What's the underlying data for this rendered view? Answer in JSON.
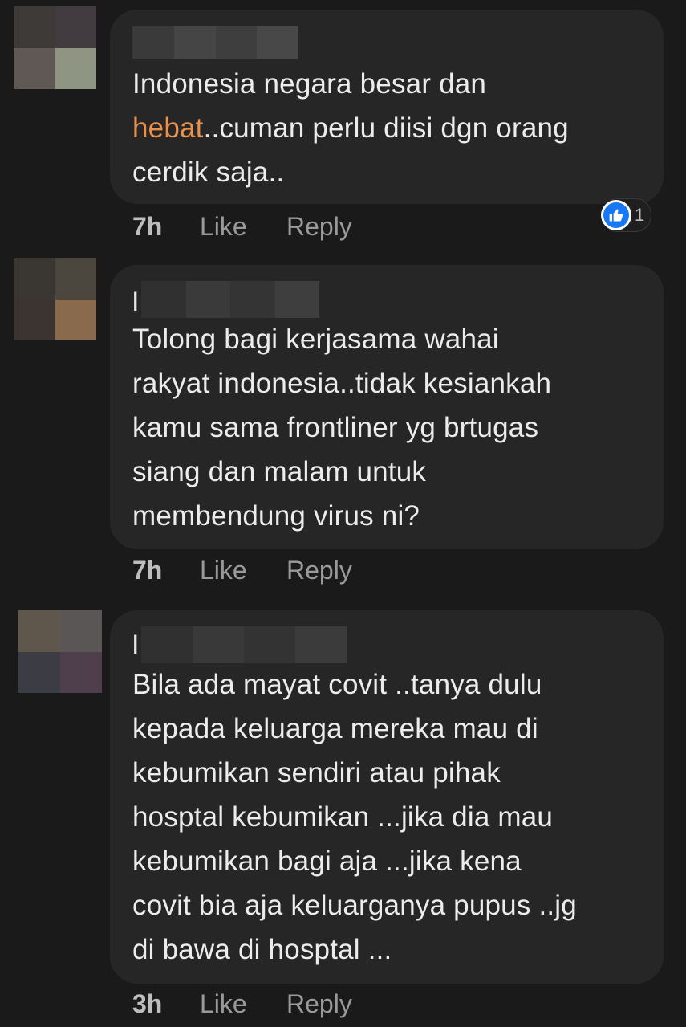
{
  "colors": {
    "background": "#1a1a1a",
    "bubble": "#262626",
    "highlight": "#e8914b",
    "like_blue": "#1877f2"
  },
  "comments": [
    {
      "author_blurred": true,
      "author_initial": "",
      "text_parts": [
        {
          "text": "Indonesia negara besar dan\n",
          "highlight": false
        },
        {
          "text": "hebat",
          "highlight": true
        },
        {
          "text": "..cuman perlu diisi dgn orang\ncerdik saja..",
          "highlight": false
        }
      ],
      "time": "7h",
      "like_label": "Like",
      "reply_label": "Reply",
      "reaction": {
        "icon": "thumbs-up-icon",
        "count": "1"
      }
    },
    {
      "author_blurred": true,
      "author_initial": "I",
      "text_parts": [
        {
          "text": "Tolong bagi kerjasama wahai\nrakyat indonesia..tidak kesiankah\nkamu sama frontliner yg brtugas\nsiang dan malam untuk\nmembendung virus ni?",
          "highlight": false
        }
      ],
      "time": "7h",
      "like_label": "Like",
      "reply_label": "Reply"
    },
    {
      "author_blurred": true,
      "author_initial": "I",
      "text_parts": [
        {
          "text": "Bila ada mayat covit ..tanya dulu\nkepada keluarga mereka mau di\nkebumikan sendiri atau pihak\nhosptal kebumikan ...jika dia mau\nkebumikan bagi aja ...jika kena\ncovit bia aja keluarganya pupus ..jg\ndi bawa di hosptal ...",
          "highlight": false
        }
      ],
      "time": "3h",
      "like_label": "Like",
      "reply_label": "Reply"
    }
  ]
}
